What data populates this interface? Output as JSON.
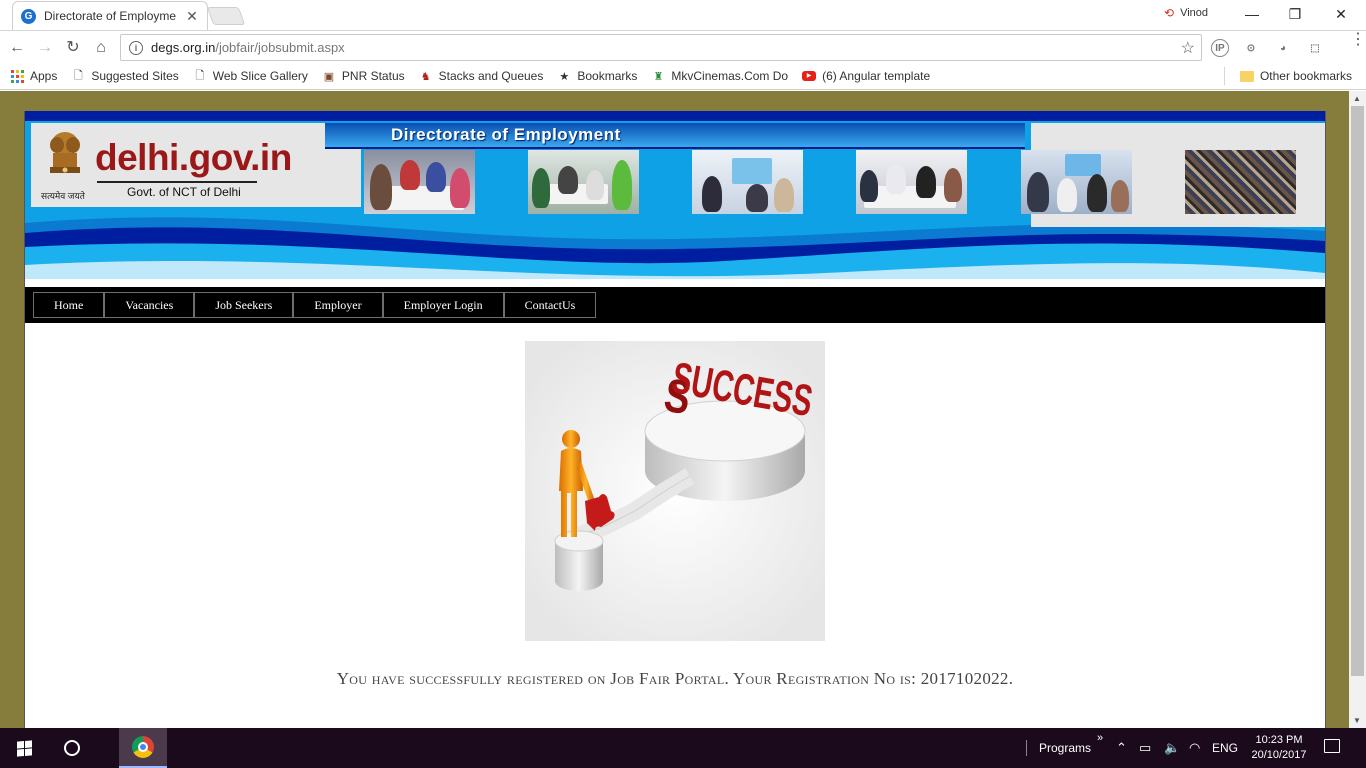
{
  "browser": {
    "tab_title": "Directorate of Employme",
    "favicon_letter": "G",
    "profile_name": "Vinod",
    "url_host": "degs.org.in",
    "url_path": "/jobfair/jobsubmit.aspx",
    "extensions": [
      "IP"
    ]
  },
  "bookmarks": [
    {
      "label": "Apps",
      "icon": "apps-grid-icon"
    },
    {
      "label": "Suggested Sites",
      "icon": "page-icon"
    },
    {
      "label": "Web Slice Gallery",
      "icon": "page-icon"
    },
    {
      "label": "PNR Status",
      "icon": "train-icon"
    },
    {
      "label": "Stacks and Queues",
      "icon": "bookmark-icon"
    },
    {
      "label": "Bookmarks",
      "icon": "star-icon"
    },
    {
      "label": "MkvCinemas.Com Do",
      "icon": "bookmark-icon"
    },
    {
      "label": "(6) Angular template",
      "icon": "youtube-icon"
    }
  ],
  "other_bookmarks": "Other bookmarks",
  "site": {
    "banner_title": "Directorate of Employment",
    "brand": "delhi.gov.in",
    "brand_sub": "Govt. of NCT of Delhi",
    "emblem_motto": "सत्यमेव जयते",
    "nav": [
      "Home",
      "Vacancies",
      "Job Seekers",
      "Employer",
      "Employer Login",
      "ContactUs"
    ],
    "success_word": "SUCCESS",
    "message": "You have successfully registered on Job Fair Portal. Your Registration No is: 2017102022."
  },
  "taskbar": {
    "programs": "Programs",
    "chevron": "»",
    "language": "ENG",
    "time": "10:23 PM",
    "date": "20/10/2017"
  },
  "colors": {
    "page_bg": "#867d3c",
    "banner_blue": "#0ea1e6",
    "banner_navy": "#001ea0",
    "brand_red": "#9a1818",
    "nav_black": "#000000",
    "taskbar": "#1a0a1c"
  }
}
